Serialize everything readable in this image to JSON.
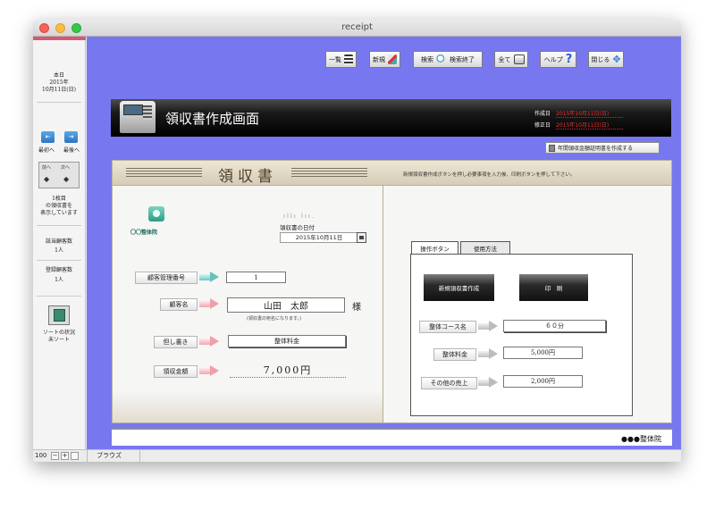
{
  "window": {
    "title": "receipt"
  },
  "sidebar": {
    "today_label": "本日",
    "today_year": "2015年",
    "today_date": "10月11日(日)",
    "nav_first": "最初へ",
    "nav_last": "最後へ",
    "record_label_1": "1枚目",
    "record_label_2": "の領収書を",
    "record_label_3": "表示しています",
    "customer_count_label": "該当顧客数",
    "customer_count": "1人",
    "registered_label": "登録顧客数",
    "registered_count": "1人",
    "sort_status_label": "ソートの状況",
    "sort_status": "未ソート",
    "sortbox_prev": "前へ",
    "sortbox_next": "次へ"
  },
  "statusbar": {
    "zoom": "100",
    "mode": "ブラウズ"
  },
  "toolbar": {
    "list_label": "一覧",
    "new_label": "新規",
    "search_label": "検索",
    "search_end_label": "検索終了",
    "all_label": "全て",
    "help_label": "ヘルプ",
    "close_label": "閉じる"
  },
  "header": {
    "title": "領収書作成画面",
    "created_label": "作成日",
    "created_value": "2015年10月11日(日)",
    "modified_label": "修正日",
    "modified_value": "2015年10月11日(日)"
  },
  "annual_button": "年間領収金額証明書を作成する",
  "receipt": {
    "title": "領収書",
    "clinic_name": "〇〇整体院",
    "date_label": "領収書の日付",
    "date_value": "2015年10月11日",
    "customer_id_label": "顧客管理番号",
    "customer_id": "1",
    "customer_name_label": "顧客名",
    "customer_name": "山田　太郎",
    "honorific": "様",
    "name_note": "(領収書の宛名になります。)",
    "memo_label": "但し書き",
    "memo": "整体料金",
    "amount_label": "領収金額",
    "amount": "7,000円"
  },
  "right_panel": {
    "instruction": "新規領収書作成ボタンを押し必要事項を入力後、印刷ボタンを押して下さい。",
    "tab_buttons": "操作ボタン",
    "tab_usage": "使用方法",
    "new_receipt_button": "新規領収書作成",
    "print_button": "印　刷",
    "course_label": "整体コース名",
    "course": "６０分",
    "fee_label": "整体料金",
    "fee": "5,000円",
    "other_label": "その他の売上",
    "other": "2,000円"
  },
  "footer": {
    "clinic": "●●●整体院"
  }
}
